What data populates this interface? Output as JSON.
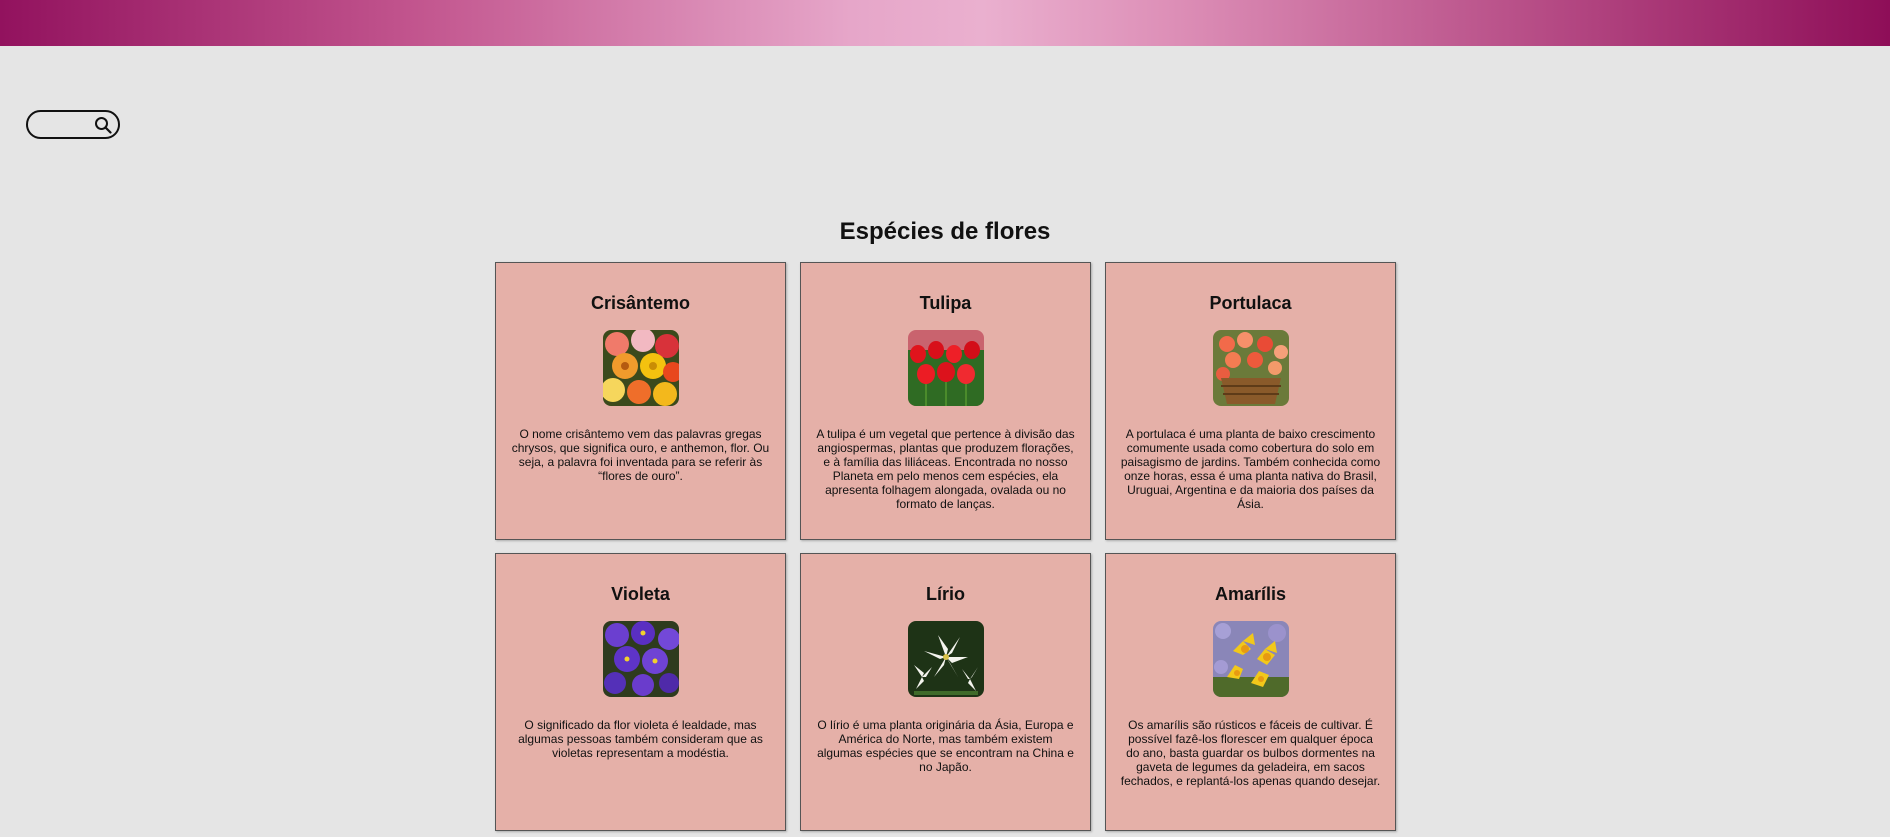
{
  "search": {
    "placeholder": ""
  },
  "main": {
    "title": "Espécies de flores",
    "cards": [
      {
        "name": "Crisântemo",
        "image_icon": "chrysanthemum-flower-image",
        "description": "O nome crisântemo vem das palavras gregas chrysos, que significa ouro, e anthemon, flor. Ou seja, a palavra foi inventada para se referir às “flores de ouro”."
      },
      {
        "name": "Tulipa",
        "image_icon": "tulip-flower-image",
        "description": "A tulipa é um vegetal que pertence à divisão das angiospermas, plantas que produzem florações, e à família das liliáceas. Encontrada no nosso Planeta em pelo menos cem espécies, ela apresenta folhagem alongada, ovalada ou no formato de lanças."
      },
      {
        "name": "Portulaca",
        "image_icon": "portulaca-flower-image",
        "description": "A portulaca é uma planta de baixo crescimento comumente usada como cobertura do solo em paisagismo de jardins. Também conhecida como onze horas, essa é uma planta nativa do Brasil, Uruguai, Argentina e da maioria dos países da Ásia."
      },
      {
        "name": "Violeta",
        "image_icon": "violet-flower-image",
        "description": "O significado da flor violeta é lealdade, mas algumas pessoas também consideram que as violetas representam a modéstia."
      },
      {
        "name": "Lírio",
        "image_icon": "lily-flower-image",
        "description": "O lírio é uma planta originária da Ásia, Europa e América do Norte, mas também existem algumas espécies que se encontram na China e no Japão."
      },
      {
        "name": "Amarílis",
        "image_icon": "amaryllis-flower-image",
        "description": "Os amarílis são rústicos e fáceis de cultivar. É possível fazê-los florescer em qualquer época do ano, basta guardar os bulbos dormentes na gaveta de legumes da geladeira, em sacos fechados, e replantá-los apenas quando desejar."
      }
    ]
  },
  "colors": {
    "header_gradient_start": "#92125e",
    "header_gradient_mid": "#eab0cf",
    "background": "#e5e5e5",
    "card_background": "#e5b0a8"
  }
}
